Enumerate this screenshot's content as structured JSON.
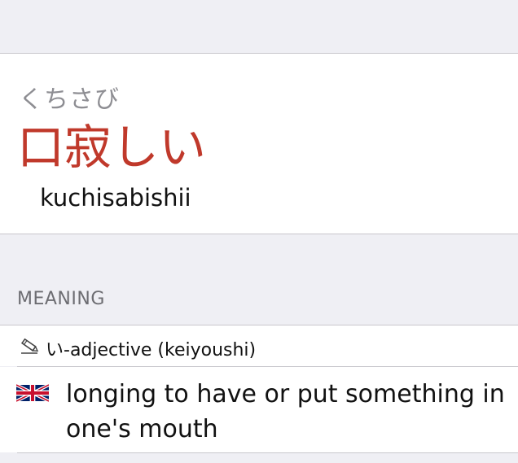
{
  "entry": {
    "reading": "くちさび",
    "word": "口寂しい",
    "romaji": "kuchisabishii"
  },
  "meaning_section": {
    "header": "MEANING",
    "part_of_speech": "い-adjective (keiyoushi)",
    "part_of_speech_icon": "pencil-icon",
    "definitions": [
      {
        "language_icon": "uk-flag-icon",
        "text": "longing to have or put something in one's mouth"
      }
    ]
  },
  "colors": {
    "accent": "#c0392b",
    "background": "#efeff4",
    "separator": "#c8c7cc",
    "secondary_text": "#8e8e93"
  }
}
